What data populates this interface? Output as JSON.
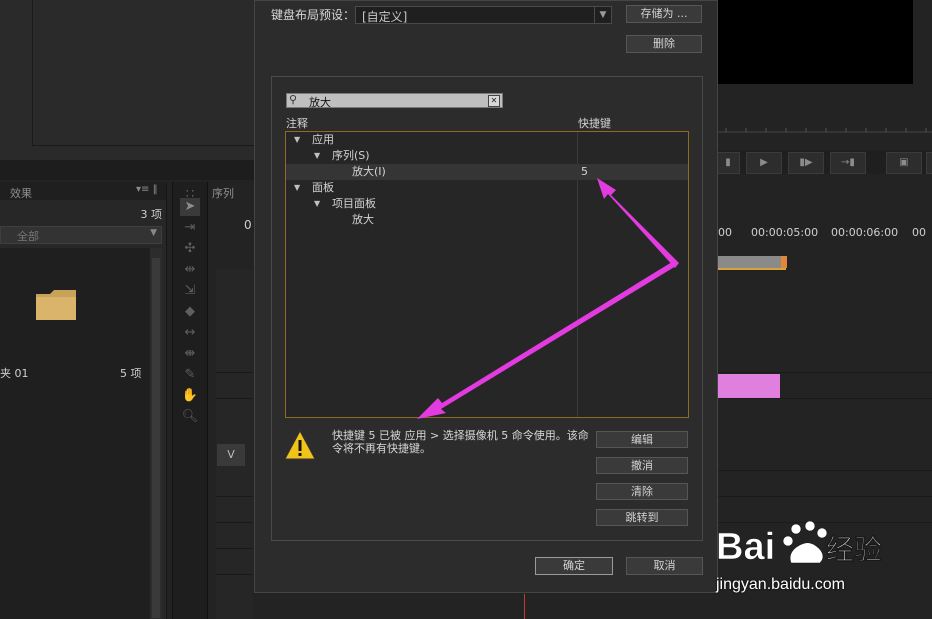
{
  "dialog": {
    "preset_label": "键盘布局预设：",
    "preset_value": "[自定义]",
    "save_as_label": "存储为 ...",
    "delete_label": "删除",
    "search_value": "放大",
    "col_note": "注释",
    "col_shortcut": "快捷键",
    "tree": [
      {
        "label": "应用",
        "level": 0,
        "expanded": true
      },
      {
        "label": "序列(S)",
        "level": 1,
        "expanded": true
      },
      {
        "label": "放大(I)",
        "level": 2,
        "shortcut": "5",
        "selected": true
      },
      {
        "label": "面板",
        "level": 0,
        "expanded": true
      },
      {
        "label": "项目面板",
        "level": 1,
        "expanded": true
      },
      {
        "label": "放大",
        "level": 2
      }
    ],
    "warning_text": "快捷键 5 已被 应用 > 选择摄像机 5 命令使用。该命令将不再有快捷键。",
    "side_buttons": [
      "编辑",
      "撤消",
      "清除",
      "跳转到"
    ],
    "ok_label": "确定",
    "cancel_label": "取消"
  },
  "project_panel": {
    "tab_label": "效果",
    "count": "3 项",
    "filter_value": "全部",
    "folder_name": "夹 01",
    "folder_count": "5 项"
  },
  "sequence_panel": {
    "tab_label": "序列",
    "time_prefix": "0",
    "track_label": "V",
    "ruler": [
      "00",
      "00:00:05:00",
      "00:00:06:00",
      "00"
    ]
  },
  "watermark": {
    "brand": "Bai",
    "brand_cn": "经验",
    "url": "jingyan.baidu.com"
  },
  "colors": {
    "arrow": "#e23be0",
    "clip": "#e07fde",
    "tree_border": "#8c6c1e"
  }
}
